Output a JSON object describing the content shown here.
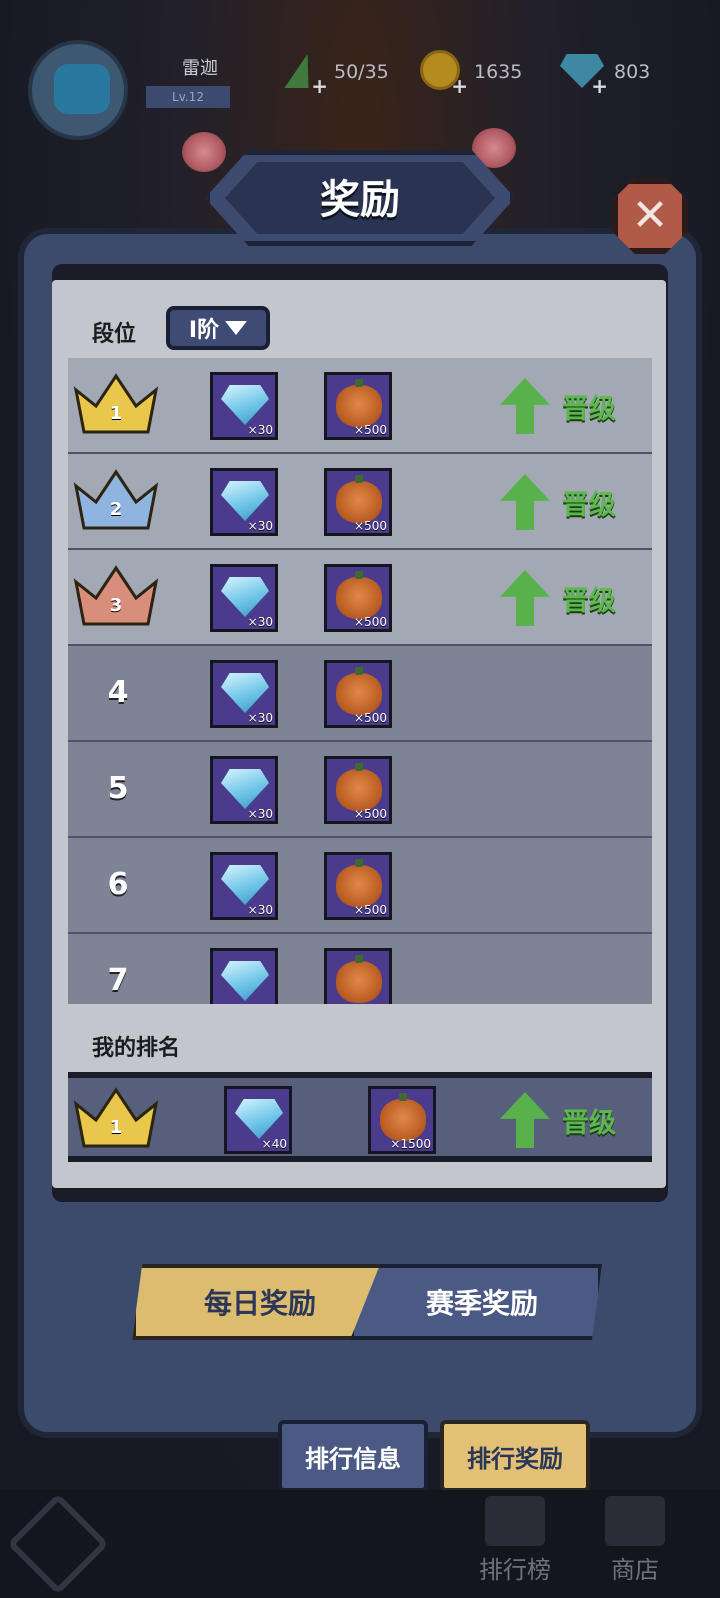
{
  "player": {
    "name": "雷迦",
    "level": "Lv.12"
  },
  "resources": {
    "energy": "50/35",
    "coins": "1635",
    "gems": "803"
  },
  "dialog": {
    "title": "奖励",
    "tier_label": "段位",
    "tier_value": "I阶"
  },
  "ranks": [
    {
      "rank": "1",
      "crown": "gold",
      "gem_qty": "×30",
      "pumpkin_qty": "×500",
      "promo": "晋级"
    },
    {
      "rank": "2",
      "crown": "blue",
      "gem_qty": "×30",
      "pumpkin_qty": "×500",
      "promo": "晋级"
    },
    {
      "rank": "3",
      "crown": "bronze",
      "gem_qty": "×30",
      "pumpkin_qty": "×500",
      "promo": "晋级"
    },
    {
      "rank": "4",
      "crown": "",
      "gem_qty": "×30",
      "pumpkin_qty": "×500",
      "promo": ""
    },
    {
      "rank": "5",
      "crown": "",
      "gem_qty": "×30",
      "pumpkin_qty": "×500",
      "promo": ""
    },
    {
      "rank": "6",
      "crown": "",
      "gem_qty": "×30",
      "pumpkin_qty": "×500",
      "promo": ""
    },
    {
      "rank": "7",
      "crown": "",
      "gem_qty": "",
      "pumpkin_qty": "",
      "promo": ""
    }
  ],
  "my_rank": {
    "label": "我的排名",
    "rank": "1",
    "gem_qty": "×40",
    "pumpkin_qty": "×1500",
    "promo": "晋级"
  },
  "reward_tabs": {
    "daily": "每日奖励",
    "season": "赛季奖励"
  },
  "bottom_tabs": {
    "info": "排行信息",
    "rewards": "排行奖励"
  },
  "nav": {
    "rank": "排行榜",
    "shop": "商店"
  },
  "colors": {
    "gold_crown": "#e8c74a",
    "blue_crown": "#8fb4e0",
    "bronze_crown": "#d98e7c",
    "promo_green": "#5cb84d"
  }
}
